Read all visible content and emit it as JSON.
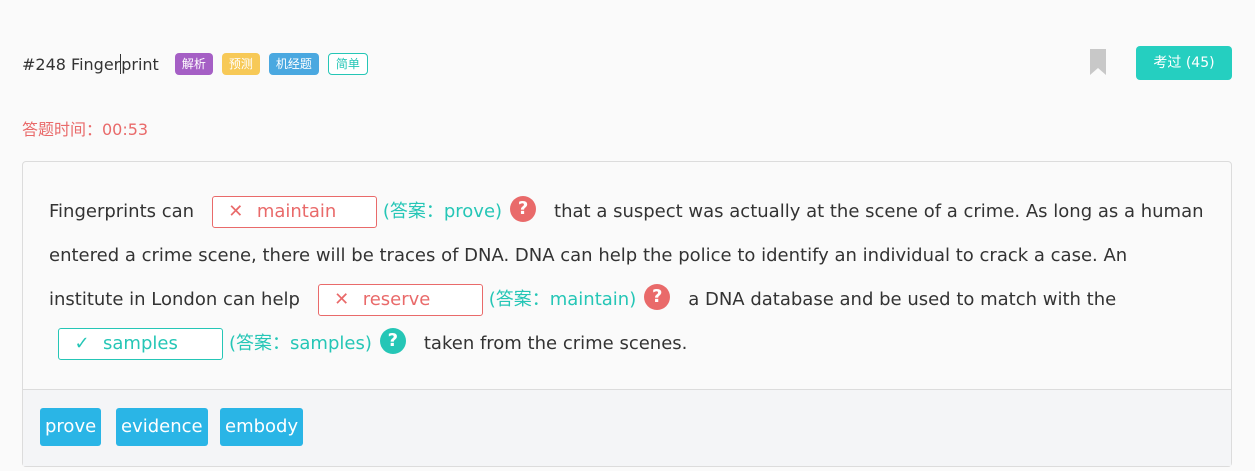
{
  "header": {
    "title_before_cursor": "#248 Finger",
    "title_after_cursor": "print",
    "tags": [
      "解析",
      "预测",
      "机经题",
      "简单"
    ],
    "pass_button": "考过 (45)"
  },
  "timer": "答题时间：00:53",
  "passage": {
    "seg1": "Fingerprints can",
    "blank1": {
      "mark": "✕",
      "word": "maintain",
      "answer": "(答案：prove)"
    },
    "seg2": "that a suspect was actually at the scene of a crime. As long as a human entered a crime scene, there will be traces of DNA. DNA can help the police to identify an individual to crack a case. An institute in London can help",
    "blank2": {
      "mark": "✕",
      "word": "reserve",
      "answer": "(答案：maintain)"
    },
    "seg3": "a DNA database and be used to match with the",
    "blank3": {
      "mark": "✓",
      "word": "samples",
      "answer": "(答案：samples)"
    },
    "seg4": "taken from the crime scenes.",
    "help_glyph": "?"
  },
  "options": [
    "prove",
    "evidence",
    "embody"
  ],
  "colors": {
    "accent": "#25c6b6",
    "error": "#e96a6a",
    "option_bg": "#2ab5e6"
  }
}
